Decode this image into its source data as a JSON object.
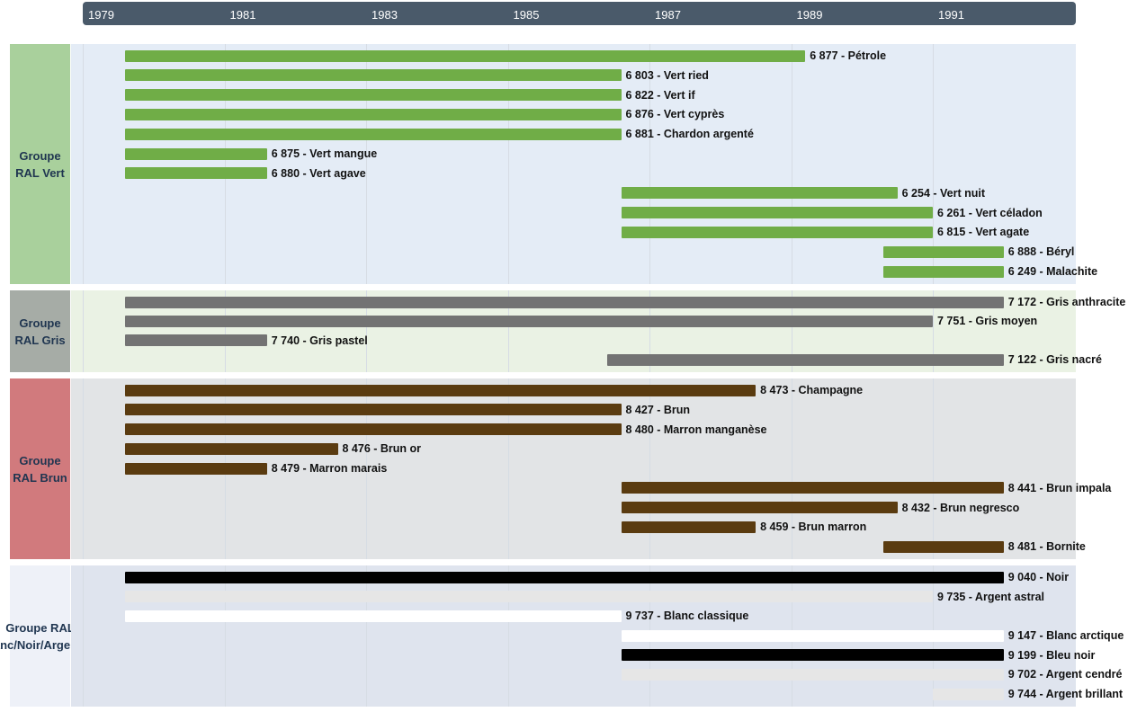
{
  "chart_data": {
    "type": "timeline",
    "x_axis": {
      "ticks": [
        "1979",
        "1981",
        "1983",
        "1985",
        "1987",
        "1989",
        "1991"
      ],
      "range": [
        1979,
        1992
      ]
    },
    "colors": {
      "axis_bar": "#4a5a6a",
      "gridline": "#d6dce4"
    },
    "groups": [
      {
        "label": "Groupe RAL Vert",
        "label_bg": "#a9d09c",
        "panel_bg": "#e4ecf6",
        "bar_color": "#70ad47",
        "items": [
          {
            "label": "6 877 - Pétrole",
            "start": 1979.6,
            "end": 1989.2
          },
          {
            "label": "6 803 - Vert ried",
            "start": 1979.6,
            "end": 1986.6
          },
          {
            "label": "6 822 - Vert if",
            "start": 1979.6,
            "end": 1986.6
          },
          {
            "label": "6 876 - Vert cyprès",
            "start": 1979.6,
            "end": 1986.6
          },
          {
            "label": "6 881 - Chardon argenté",
            "start": 1979.6,
            "end": 1986.6
          },
          {
            "label": "6 875 - Vert mangue",
            "start": 1979.6,
            "end": 1981.6
          },
          {
            "label": "6 880 - Vert agave",
            "start": 1979.6,
            "end": 1981.6
          },
          {
            "label": "6 254 - Vert nuit",
            "start": 1986.6,
            "end": 1990.5
          },
          {
            "label": "6 261 - Vert céladon",
            "start": 1986.6,
            "end": 1991.0
          },
          {
            "label": "6 815 - Vert agate",
            "start": 1986.6,
            "end": 1991.0
          },
          {
            "label": "6 888 - Béryl",
            "start": 1990.3,
            "end": 1992.0
          },
          {
            "label": "6 249 - Malachite",
            "start": 1990.3,
            "end": 1992.0
          }
        ]
      },
      {
        "label": "Groupe RAL Gris",
        "label_bg": "#a6aca6",
        "panel_bg": "#eaf2e4",
        "bar_color": "#737373",
        "items": [
          {
            "label": "7 172 - Gris anthracite",
            "start": 1979.6,
            "end": 1992.0
          },
          {
            "label": "7 751 - Gris moyen",
            "start": 1979.6,
            "end": 1991.0
          },
          {
            "label": "7 740 - Gris pastel",
            "start": 1979.6,
            "end": 1981.6
          },
          {
            "label": "7 122 - Gris nacré",
            "start": 1986.4,
            "end": 1992.0
          }
        ]
      },
      {
        "label": "Groupe RAL Brun",
        "label_bg": "#d17a7d",
        "panel_bg": "#e2e4e6",
        "bar_color": "#5a3b10",
        "items": [
          {
            "label": "8 473 - Champagne",
            "start": 1979.6,
            "end": 1988.5
          },
          {
            "label": "8 427 - Brun",
            "start": 1979.6,
            "end": 1986.6
          },
          {
            "label": "8 480 - Marron manganèse",
            "start": 1979.6,
            "end": 1986.6
          },
          {
            "label": "8 476 - Brun or",
            "start": 1979.6,
            "end": 1982.6
          },
          {
            "label": "8 479 - Marron marais",
            "start": 1979.6,
            "end": 1981.6
          },
          {
            "label": "8 441 - Brun impala",
            "start": 1986.6,
            "end": 1992.0
          },
          {
            "label": "8 432 - Brun negresco",
            "start": 1986.6,
            "end": 1990.5
          },
          {
            "label": "8 459 - Brun marron",
            "start": 1986.6,
            "end": 1988.5
          },
          {
            "label": "8 481 - Bornite",
            "start": 1990.3,
            "end": 1992.0
          }
        ]
      },
      {
        "label": "Groupe RAL Blanc/Noir/Argent/Or",
        "label_bg": "#eef1f8",
        "panel_bg": "#dfe4ee",
        "items": [
          {
            "label": "9 040 - Noir",
            "start": 1979.6,
            "end": 1992.0,
            "color": "#000000"
          },
          {
            "label": "9 735 - Argent astral",
            "start": 1979.6,
            "end": 1991.0,
            "color": "#e6e6e6"
          },
          {
            "label": "9 737 - Blanc classique",
            "start": 1979.6,
            "end": 1986.6,
            "color": "#ffffff"
          },
          {
            "label": "9 147 - Blanc arctique",
            "start": 1986.6,
            "end": 1992.0,
            "color": "#ffffff"
          },
          {
            "label": "9 199 - Bleu noir",
            "start": 1986.6,
            "end": 1992.0,
            "color": "#000000"
          },
          {
            "label": "9 702 - Argent cendré",
            "start": 1986.6,
            "end": 1992.0,
            "color": "#e6e6e6"
          },
          {
            "label": "9 744 - Argent brillant",
            "start": 1991.0,
            "end": 1992.0,
            "color": "#e6e6e6"
          }
        ]
      }
    ]
  }
}
